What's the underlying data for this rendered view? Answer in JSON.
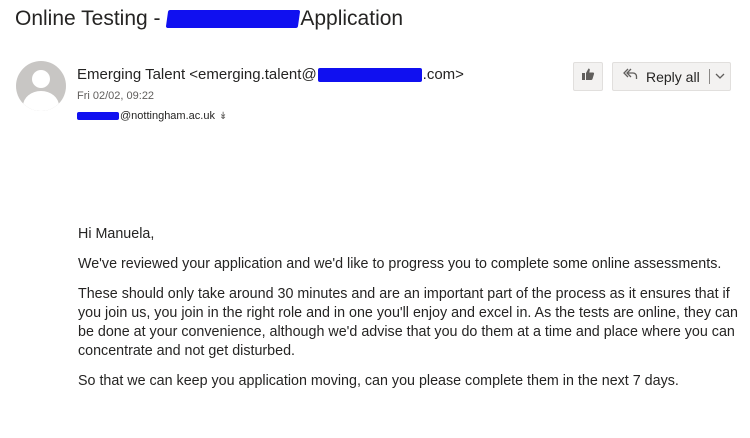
{
  "message": {
    "subject_prefix": "Online Testing - ",
    "subject_suffix": "Application",
    "sender_prefix": "Emerging Talent <emerging.talent@",
    "sender_suffix": ".com>",
    "date": "Fri 02/02, 09:22",
    "recipient_suffix": "@nottingham.ac.uk"
  },
  "actions": {
    "react_icon": "thumbs-up-icon",
    "reply_all_icon": "reply-all-icon",
    "reply_all_label": "Reply all",
    "more_icon": "chevron-down-icon",
    "recipient_expand_icon": "chevron-double-down-icon"
  },
  "body": {
    "greeting": "Hi Manuela,",
    "paragraph_1": "We've reviewed your application and we'd like to progress you to complete some online assessments.",
    "paragraph_2": "These should only take around 30 minutes and are an important part of the process as it ensures that if you join us, you join in the right role and in one you'll enjoy and excel in. As the tests are online, they can be done at your convenience, although we'd advise that you do them at a time and place where you can concentrate and not get disturbed.",
    "paragraph_3": "So that we can keep you application moving, can you please complete them in the next 7 days."
  },
  "colors": {
    "redaction": "#1010f0",
    "avatar_bg": "#c8c6c4",
    "button_bg": "#f3f2f1",
    "text": "#252423",
    "muted_text": "#605e5c"
  }
}
